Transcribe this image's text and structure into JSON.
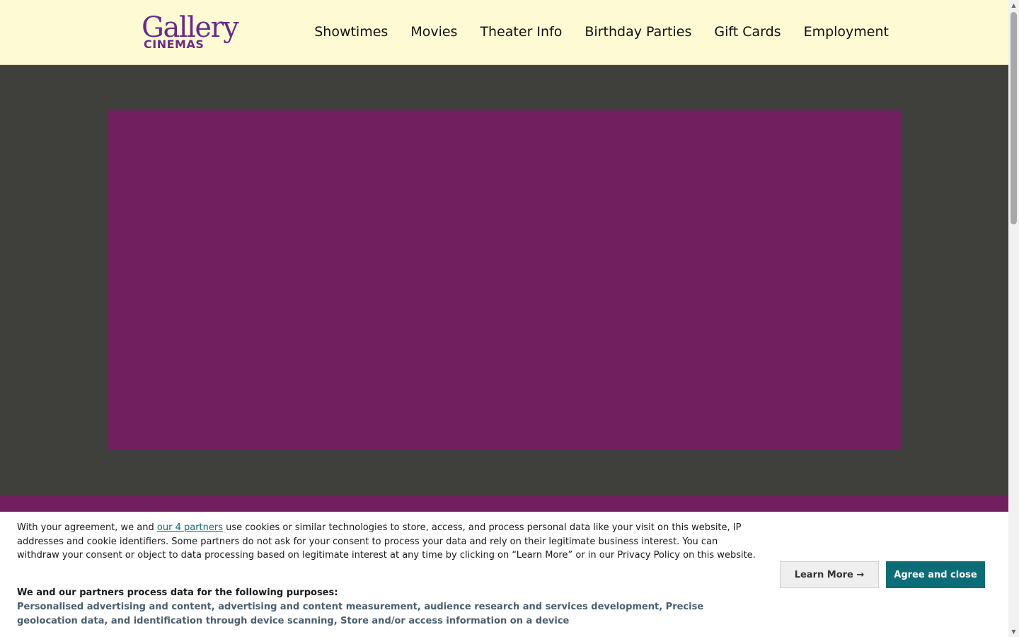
{
  "header": {
    "logo": {
      "line1": "Gallery",
      "line2": "CINEMAS"
    },
    "nav": [
      {
        "label": "Showtimes"
      },
      {
        "label": "Movies"
      },
      {
        "label": "Theater Info"
      },
      {
        "label": "Birthday Parties"
      },
      {
        "label": "Gift Cards"
      },
      {
        "label": "Employment"
      }
    ]
  },
  "consent": {
    "text_before_link": "With your agreement, we and ",
    "link_text": "our 4 partners",
    "text_after_link": " use cookies or similar technologies to store, access, and process personal data like your visit on this website, IP addresses and cookie identifiers. Some partners do not ask for your consent to process your data and rely on their legitimate business interest. You can withdraw your consent or object to data processing based on legitimate interest at any time by clicking on “Learn More” or in our Privacy Policy on this website.",
    "purposes_title": "We and our partners process data for the following purposes:",
    "purposes_list": "Personalised advertising and content, advertising and content measurement, audience research and services development, Precise geolocation data, and identification through device scanning, Store and/or access information on a device",
    "learn_more_label": "Learn More →",
    "agree_label": "Agree and close"
  },
  "colors": {
    "header_bg": "#fefad3",
    "page_bg": "#3f403c",
    "brand_purple": "#711f5f",
    "logo_purple": "#6a2b86",
    "accent_teal": "#0d6d77"
  },
  "scrollbar": {
    "up_icon": "▲",
    "down_icon": "▼"
  }
}
